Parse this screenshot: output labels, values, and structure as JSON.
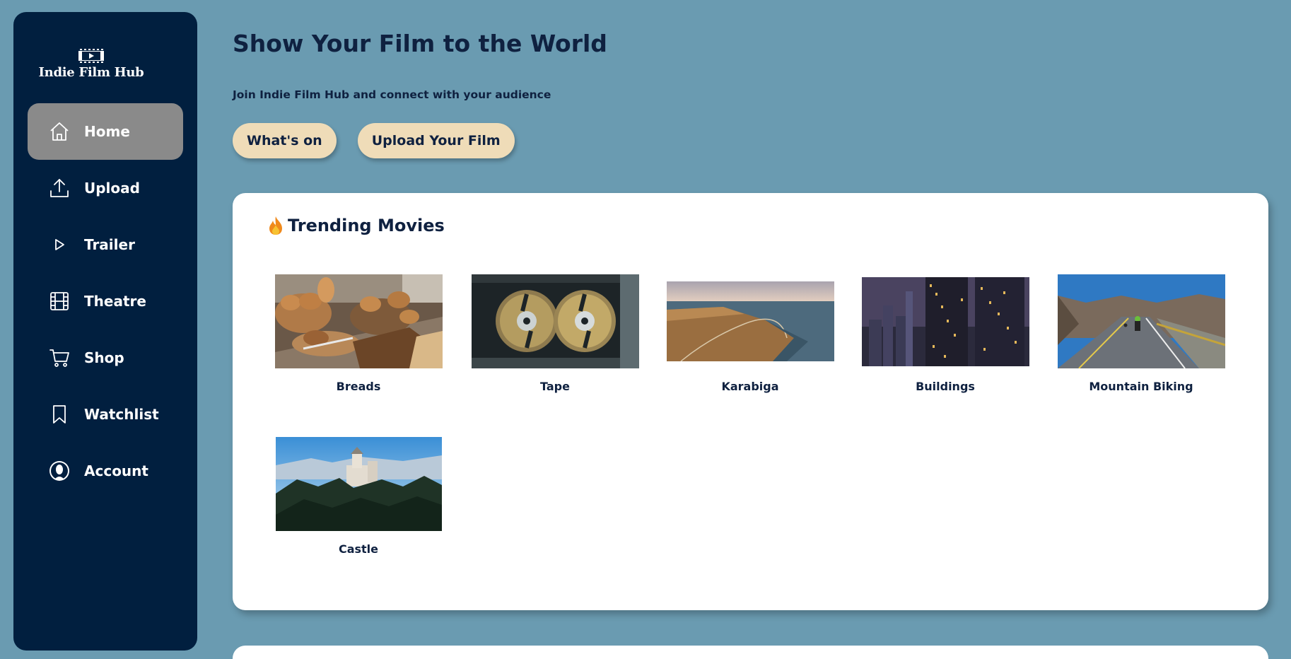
{
  "app": {
    "name": "Indie Film Hub",
    "accent": "#011f3f",
    "background": "#6a9bb1",
    "button_color": "#efdcb8"
  },
  "sidebar": {
    "items": [
      {
        "label": "Home",
        "icon": "home-icon",
        "active": true
      },
      {
        "label": "Upload",
        "icon": "upload-icon",
        "active": false
      },
      {
        "label": "Trailer",
        "icon": "play-icon",
        "active": false
      },
      {
        "label": "Theatre",
        "icon": "film-icon",
        "active": false
      },
      {
        "label": "Shop",
        "icon": "cart-icon",
        "active": false
      },
      {
        "label": "Watchlist",
        "icon": "bookmark-icon",
        "active": false
      },
      {
        "label": "Account",
        "icon": "user-icon",
        "active": false
      }
    ]
  },
  "hero": {
    "title": "Show Your Film to the World",
    "subtitle": "Join Indie Film Hub and connect with your audience",
    "buttons": [
      "What's on",
      "Upload Your Film"
    ]
  },
  "trending": {
    "title": "Trending Movies",
    "icon": "fire-icon",
    "movies": [
      {
        "title": "Breads"
      },
      {
        "title": "Tape"
      },
      {
        "title": "Karabiga"
      },
      {
        "title": "Buildings"
      },
      {
        "title": "Mountain Biking"
      },
      {
        "title": "Castle"
      }
    ]
  }
}
